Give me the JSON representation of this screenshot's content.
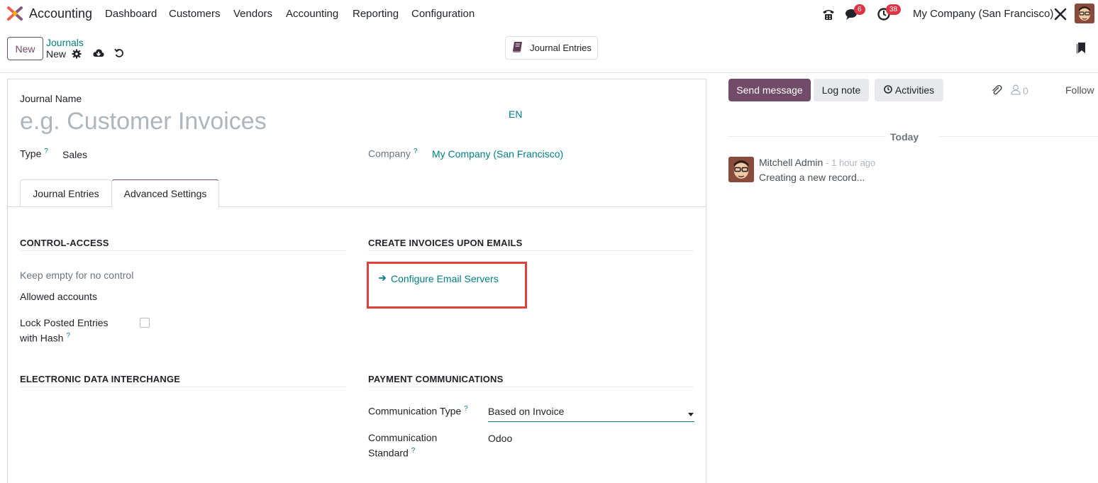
{
  "navbar": {
    "app_name": "Accounting",
    "menu": [
      "Dashboard",
      "Customers",
      "Vendors",
      "Accounting",
      "Reporting",
      "Configuration"
    ],
    "messages_badge": "6",
    "activities_badge": "38",
    "company": "My Company (San Francisco)"
  },
  "control_panel": {
    "new_label": "New",
    "breadcrumb_parent": "Journals",
    "breadcrumb_current": "New",
    "smart_button": "Journal Entries"
  },
  "form": {
    "journal_name_label": "Journal Name",
    "journal_name_placeholder": "e.g. Customer Invoices",
    "lang": "EN",
    "type_label": "Type",
    "type_value": "Sales",
    "company_label": "Company",
    "company_value": "My Company (San Francisco)",
    "help_mark": "?",
    "tabs": [
      "Journal Entries",
      "Advanced Settings"
    ],
    "control_access": {
      "title": "CONTROL-ACCESS",
      "hint": "Keep empty for no control",
      "allowed_accounts": "Allowed accounts",
      "lock_posted_1": "Lock Posted Entries",
      "lock_posted_2": "with Hash"
    },
    "create_invoices": {
      "title": "CREATE INVOICES UPON EMAILS",
      "configure_link": "Configure Email Servers"
    },
    "edi": {
      "title": "ELECTRONIC DATA INTERCHANGE"
    },
    "payment": {
      "title": "PAYMENT COMMUNICATIONS",
      "comm_type_label": "Communication Type",
      "comm_type_value": "Based on Invoice",
      "comm_standard_label_1": "Communication",
      "comm_standard_label_2": "Standard",
      "comm_standard_value": "Odoo"
    }
  },
  "chatter": {
    "send_message": "Send message",
    "log_note": "Log note",
    "activities": "Activities",
    "followers_count": "0",
    "follow": "Follow",
    "today": "Today",
    "message": {
      "author": "Mitchell Admin",
      "time": "- 1 hour ago",
      "body": "Creating a new record..."
    }
  },
  "colors": {
    "brand": "#714b67",
    "link": "#017e84",
    "highlight": "#e0413a",
    "badge": "#dc3545"
  }
}
